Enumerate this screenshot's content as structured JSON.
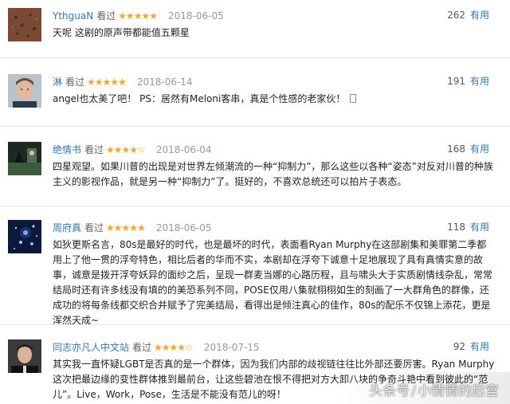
{
  "reviews": [
    {
      "user": "YthguaN",
      "watched": "看过",
      "stars": "★★★★★",
      "date": "2018-06-05",
      "votes": "262",
      "useful": "有用",
      "text": "天呢 这剧的原声带都能值五颗星"
    },
    {
      "user": "淋",
      "watched": "看过",
      "stars": "★★★★★",
      "date": "2018-06-14",
      "votes": "191",
      "useful": "有用",
      "text": "angel也太美了吧！ PS：居然有Meloni客串，真是个性感的老家伙！"
    },
    {
      "user": "绝情书",
      "watched": "看过",
      "stars": "★★★★☆",
      "date": "2018-06-04",
      "votes": "168",
      "useful": "有用",
      "text": "四星观望。如果川普的出现是对世界左倾潮流的一种“抑制力”，那么这些以各种“姿态”对反对川普的种族主义的影视作品，就是另一种“抑制力”了。挺好的，不喜欢总统还可以拍片子表态。"
    },
    {
      "user": "周府真",
      "watched": "看过",
      "stars": "★★★★★",
      "date": "2018-06-05",
      "votes": "118",
      "useful": "有用",
      "text": "如狄更斯名言，80s是最好的时代，也是最坏的时代，表面看Ryan Murphy在这部剧集和美罪第二季都用上了他一贯的浮夸特色，相比后者的华而不实，本剧却在浮夸下诚意十足地展现了具有真情实意的故事，诚意是拨开浮夸妖异的面纱之后，呈现一群麦当娜的心路历程，且与啸头大于实质剧情线杂乱，常常结局时还有许多线没有填的的美恐系列不同，POSE仅用八集就栩栩如生的刻画了一大群角色的群像，还成功的将每条线都交织合并赋予了完美结局，看得出是倾注真心的佳作，80s的配乐不仅锦上添花，更是浑然天成~"
    },
    {
      "user": "同志亦凡人中文站",
      "watched": "看过",
      "stars": "★★★★☆",
      "date": "2018-07-15",
      "votes": "92",
      "useful": "有用",
      "text": "其实我一直怀疑LGBT是否真的是一个群体，因为我们内部的歧视链往往比外部还要厉害。Ryan Murphy这次把最边缘的变性群体推到最前台，让这些碧池在恨不得把对方大卸八块的争奇斗艳中看到彼此的“范儿”。Live，Work，Pose，生活是不能没有范儿的呀！"
    }
  ],
  "watermark": {
    "left": "头条号",
    "right": "小情情的后宫"
  }
}
